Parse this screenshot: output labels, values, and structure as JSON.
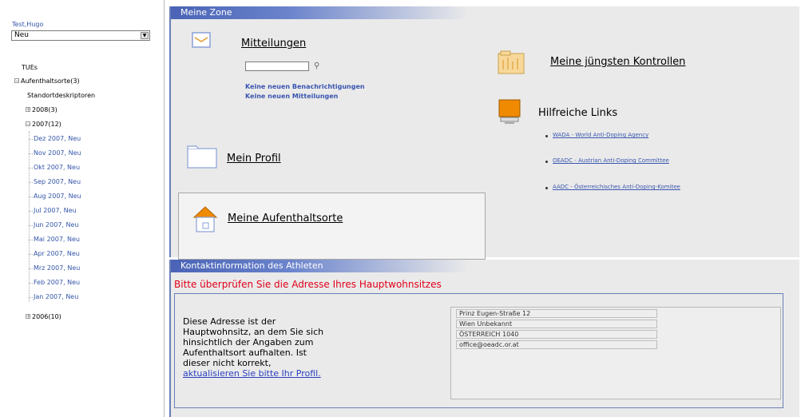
{
  "sidebar": {
    "user_name": "Test,Hugo",
    "status_value": "Neu",
    "tree": {
      "tues": "TUEs",
      "aufenthaltsorte": "Aufenthaltsorte(3)",
      "standort": "Standortdeskriptoren",
      "y2008": "2008(3)",
      "y2007": "2007(12)",
      "months": [
        "Dez 2007, Neu",
        "Nov 2007, Neu",
        "Okt 2007, Neu",
        "Sep 2007, Neu",
        "Aug 2007, Neu",
        "Jul 2007, Neu",
        "Jun 2007, Neu",
        "Mai 2007, Neu",
        "Apr 2007, Neu",
        "Mrz 2007, Neu",
        "Feb 2007, Neu",
        "Jan 2007, Neu"
      ],
      "y2006": "2006(10)"
    }
  },
  "zone": {
    "title": "Meine Zone",
    "mitteilungen": "Mitteilungen",
    "no_notifications": "Keine neuen Benachrichtigungen",
    "no_messages": "Keine neuen Mitteilungen",
    "kontrollen": "Meine jüngsten Kontrollen",
    "hilfreiche": "Hilfreiche Links",
    "links": [
      "WADA - World Anti-Doping Agency",
      "OEADC - Austrian Anti-Doping Committee",
      "AADC - Österreichisches Anti-Doping-Komitee"
    ],
    "profil": "Mein Profil",
    "aufenthaltsorte": "Meine Aufenthaltsorte"
  },
  "contact": {
    "title": "Kontaktinformation des Athleten",
    "warning": "Bitte überprüfen Sie die Adresse Ihres Hauptwohnsitzes",
    "text": "Diese Adresse ist der Hauptwohnsitz, an dem Sie sich hinsichtlich der Angaben zum Aufenthaltsort aufhalten. Ist dieser nicht korrekt,",
    "update_link": "aktualisieren Sie bitte Ihr Profil.",
    "address": [
      "Prinz Eugen-Straße 12",
      "Wien  Unbekannt",
      "ÖSTERREICH 1040",
      "office@oeadc.or.at"
    ]
  },
  "colors": {
    "accent": "#4a63b6",
    "warning": "#e0001a",
    "link": "#3a56b0"
  }
}
